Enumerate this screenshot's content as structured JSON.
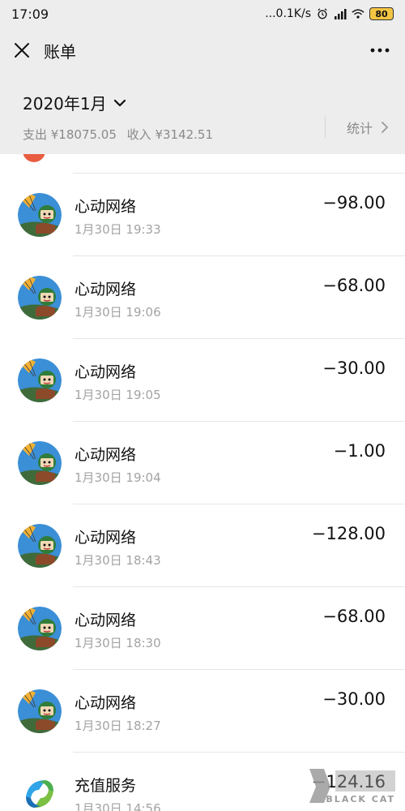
{
  "status_bar": {
    "time": "17:09",
    "net_speed": "...0.1K/s",
    "battery": "80"
  },
  "title_bar": {
    "title": "账单"
  },
  "month_header": {
    "month": "2020年1月",
    "expense": "支出 ¥18075.05",
    "income": "收入 ¥3142.51",
    "stats_label": "统计"
  },
  "transactions": [
    {
      "name": "心动网络",
      "time": "1月30日 19:33",
      "amount": "−98.00",
      "icon": "game-avatar-icon"
    },
    {
      "name": "心动网络",
      "time": "1月30日 19:06",
      "amount": "−68.00",
      "icon": "game-avatar-icon"
    },
    {
      "name": "心动网络",
      "time": "1月30日 19:05",
      "amount": "−30.00",
      "icon": "game-avatar-icon"
    },
    {
      "name": "心动网络",
      "time": "1月30日 19:04",
      "amount": "−1.00",
      "icon": "game-avatar-icon"
    },
    {
      "name": "心动网络",
      "time": "1月30日 18:43",
      "amount": "−128.00",
      "icon": "game-avatar-icon"
    },
    {
      "name": "心动网络",
      "time": "1月30日 18:30",
      "amount": "−68.00",
      "icon": "game-avatar-icon"
    },
    {
      "name": "心动网络",
      "time": "1月30日 18:27",
      "amount": "−30.00",
      "icon": "game-avatar-icon"
    },
    {
      "name": "充值服务",
      "time": "1月30日 14:56",
      "amount": "−124.16",
      "icon": "recharge-service-icon"
    }
  ],
  "watermark": {
    "text": "BLACK CAT"
  },
  "colors": {
    "header_bg": "#ededed",
    "list_bg": "#ffffff",
    "muted_text": "#8a8a8a"
  }
}
